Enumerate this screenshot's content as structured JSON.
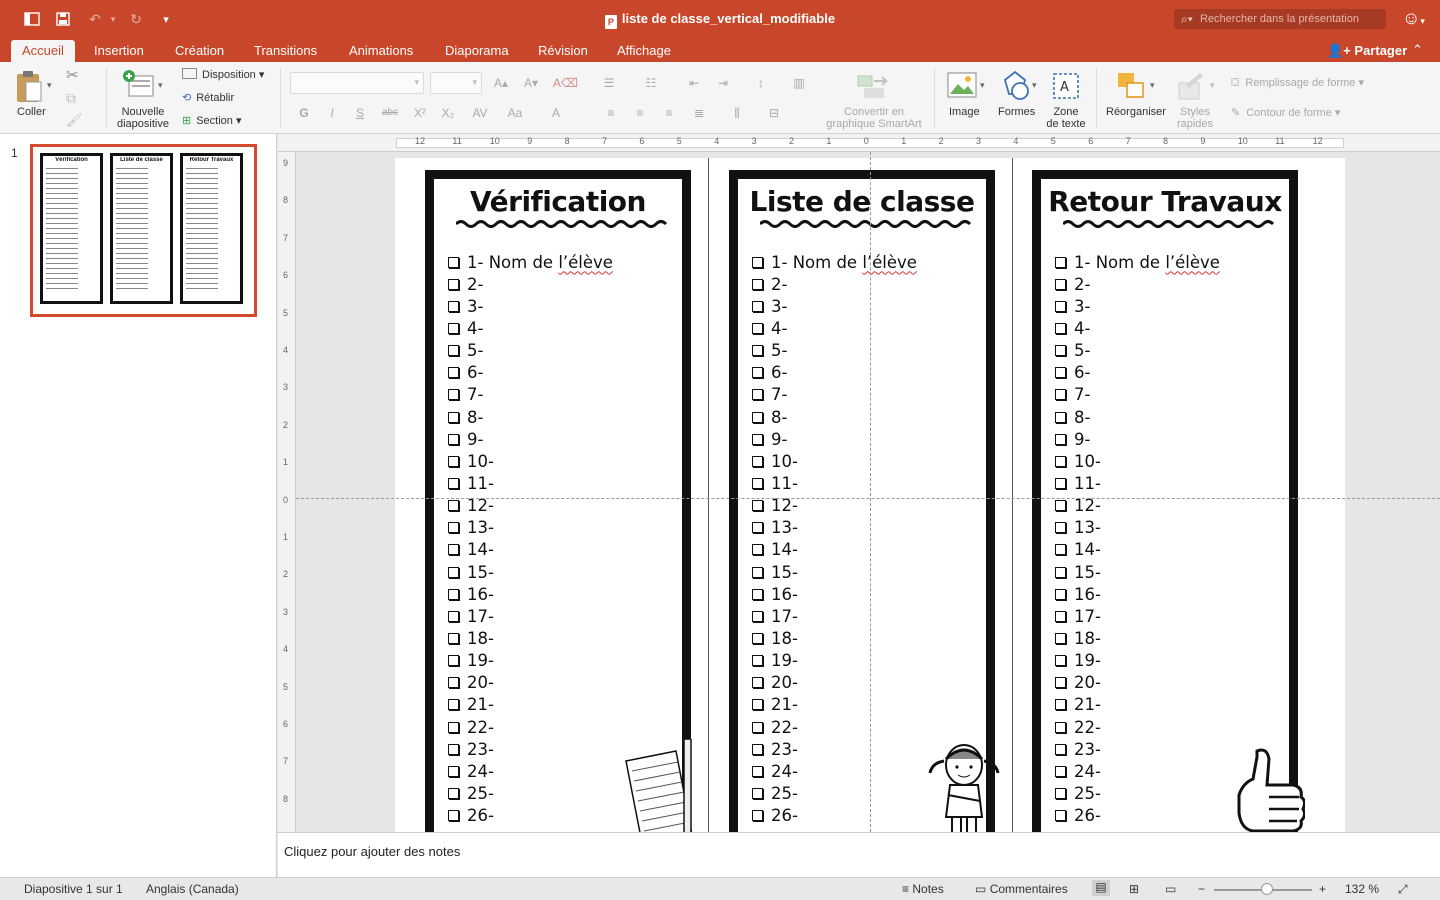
{
  "window": {
    "title": "liste de classe_vertical_modifiable",
    "search_placeholder": "Rechercher dans la présentation"
  },
  "tabs": [
    "Accueil",
    "Insertion",
    "Création",
    "Transitions",
    "Animations",
    "Diaporama",
    "Révision",
    "Affichage"
  ],
  "active_tab": "Accueil",
  "share_label": "Partager",
  "ribbon": {
    "paste": "Coller",
    "new_slide_line1": "Nouvelle",
    "new_slide_line2": "diapositive",
    "layout": "Disposition",
    "reset": "Rétablir",
    "section": "Section",
    "smartart_line1": "Convertir en",
    "smartart_line2": "graphique SmartArt",
    "image": "Image",
    "shapes": "Formes",
    "textbox_line1": "Zone",
    "textbox_line2": "de texte",
    "arrange": "Réorganiser",
    "quick_styles_line1": "Styles",
    "quick_styles_line2": "rapides",
    "shape_fill": "Remplissage de forme",
    "shape_outline": "Contour de forme",
    "bold": "G",
    "italic": "I",
    "underline": "S",
    "strike": "abc"
  },
  "thumbnails": [
    {
      "number": "1"
    }
  ],
  "slide": {
    "cards": [
      {
        "title": "Vérification",
        "first_item": "1- Nom de l’élève"
      },
      {
        "title": "Liste de classe",
        "first_item": "1- Nom de l’élève"
      },
      {
        "title": "Retour Travaux",
        "first_item": "1- Nom de l’élève"
      }
    ],
    "items": [
      "2-",
      "3-",
      "4-",
      "5-",
      "6-",
      "7-",
      "8-",
      "9-",
      "10-",
      "11-",
      "12-",
      "13-",
      "14-",
      "15-",
      "16-",
      "17-",
      "18-",
      "19-",
      "20-",
      "21-",
      "22-",
      "23-",
      "24-",
      "25-",
      "26-"
    ]
  },
  "ruler": {
    "h_ticks": [
      "12",
      "11",
      "10",
      "9",
      "8",
      "7",
      "6",
      "5",
      "4",
      "3",
      "2",
      "1",
      "0",
      "1",
      "2",
      "3",
      "4",
      "5",
      "6",
      "7",
      "8",
      "9",
      "10",
      "11",
      "12"
    ],
    "v_ticks": [
      "9",
      "8",
      "7",
      "6",
      "5",
      "4",
      "3",
      "2",
      "1",
      "0",
      "1",
      "2",
      "3",
      "4",
      "5",
      "6",
      "7",
      "8"
    ]
  },
  "notes_placeholder": "Cliquez pour ajouter des notes",
  "status": {
    "slide_info": "Diapositive 1 sur 1",
    "language": "Anglais (Canada)",
    "notes": "Notes",
    "comments": "Commentaires",
    "zoom": "132 %"
  },
  "colors": {
    "accent": "#c8472b",
    "selection": "#d34a2e"
  }
}
